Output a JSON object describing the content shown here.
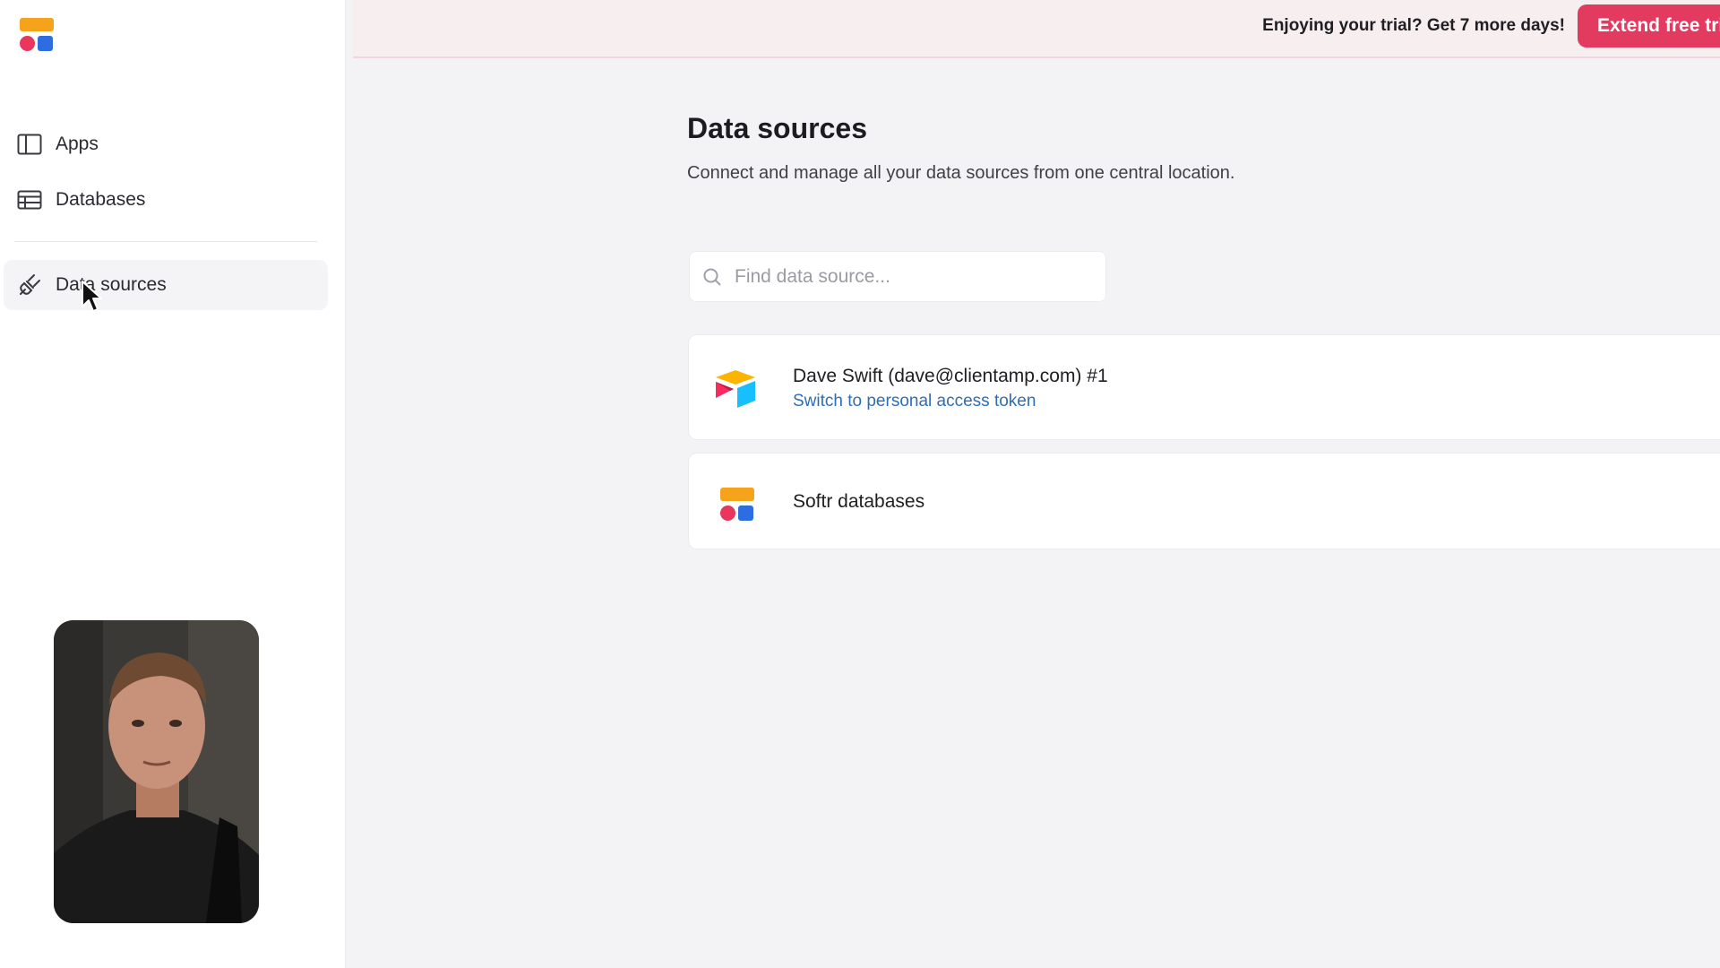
{
  "colors": {
    "accent": "#e33a5f",
    "banner_bg": "#f7eef0",
    "link": "#2f6db5",
    "logo_orange": "#f5a31a",
    "logo_red": "#e8365d",
    "logo_blue": "#2e6de0"
  },
  "sidebar": {
    "items": [
      {
        "label": "Apps",
        "icon": "apps-panel-icon"
      },
      {
        "label": "Databases",
        "icon": "database-table-icon"
      },
      {
        "label": "Data sources",
        "icon": "plug-icon",
        "active": true
      }
    ]
  },
  "banner": {
    "text": "Enjoying your trial? Get 7 more days!",
    "button_label": "Extend free tri"
  },
  "main": {
    "title": "Data sources",
    "subtitle": "Connect and manage all your data sources from one central location.",
    "search": {
      "placeholder": "Find data source..."
    },
    "sources": [
      {
        "name": "Dave Swift (dave@clientamp.com) #1",
        "link": "Switch to personal access token",
        "icon": "airtable-logo-icon"
      },
      {
        "name": "Softr databases",
        "icon": "softr-logo-icon"
      }
    ]
  }
}
